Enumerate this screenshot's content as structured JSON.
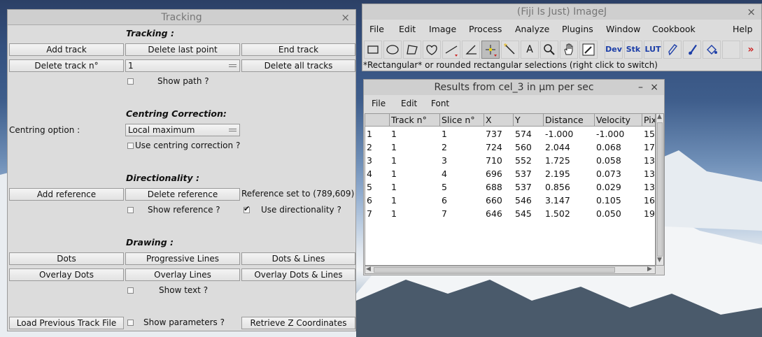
{
  "tracking": {
    "title": "Tracking",
    "close": "×",
    "sections": {
      "tracking": "Tracking :",
      "centring": "Centring Correction:",
      "directionality": "Directionality :",
      "drawing": "Drawing :"
    },
    "add_track": "Add track",
    "delete_last_point": "Delete last point",
    "end_track": "End track",
    "delete_track_n": "Delete track n°",
    "track_select_value": "1",
    "delete_all_tracks": "Delete all tracks",
    "show_path": "Show path ?",
    "centring_option_label": "Centring option :",
    "centring_select_value": "Local maximum",
    "use_centring_correction": "Use centring correction ?",
    "add_reference": "Add reference",
    "delete_reference": "Delete reference",
    "reference_set": "Reference set to (789,609)",
    "show_reference": "Show reference ?",
    "use_directionality": "Use directionality ?",
    "dots": "Dots",
    "progressive_lines": "Progressive Lines",
    "dots_lines": "Dots & Lines",
    "overlay_dots": "Overlay Dots",
    "overlay_lines": "Overlay Lines",
    "overlay_dots_lines": "Overlay Dots & Lines",
    "show_text": "Show text ?",
    "load_previous": "Load Previous Track File",
    "show_parameters": "Show parameters ?",
    "retrieve_z": "Retrieve Z Coordinates"
  },
  "imagej": {
    "title": "(Fiji Is Just) ImageJ",
    "close": "×",
    "menu": [
      "File",
      "Edit",
      "Image",
      "Process",
      "Analyze",
      "Plugins",
      "Window",
      "Cookbook",
      "Help"
    ],
    "tools": {
      "text_tool": "A",
      "dev": "Dev",
      "stk": "Stk",
      "lut": "LUT",
      "more": "»"
    },
    "status": "*Rectangular* or rounded rectangular selections (right click to switch)"
  },
  "results": {
    "title": "Results from cel_3 in µm per sec",
    "minimize": "–",
    "close": "×",
    "menu": [
      "File",
      "Edit",
      "Font"
    ],
    "columns": [
      "",
      "Track n°",
      "Slice n°",
      "X",
      "Y",
      "Distance",
      "Velocity",
      "Pix"
    ],
    "rows": [
      [
        "1",
        "1",
        "1",
        "737",
        "574",
        "-1.000",
        "-1.000",
        "15"
      ],
      [
        "2",
        "1",
        "2",
        "724",
        "560",
        "2.044",
        "0.068",
        "17"
      ],
      [
        "3",
        "1",
        "3",
        "710",
        "552",
        "1.725",
        "0.058",
        "13"
      ],
      [
        "4",
        "1",
        "4",
        "696",
        "537",
        "2.195",
        "0.073",
        "13"
      ],
      [
        "5",
        "1",
        "5",
        "688",
        "537",
        "0.856",
        "0.029",
        "13"
      ],
      [
        "6",
        "1",
        "6",
        "660",
        "546",
        "3.147",
        "0.105",
        "16"
      ],
      [
        "7",
        "1",
        "7",
        "646",
        "545",
        "1.502",
        "0.050",
        "19"
      ]
    ]
  }
}
